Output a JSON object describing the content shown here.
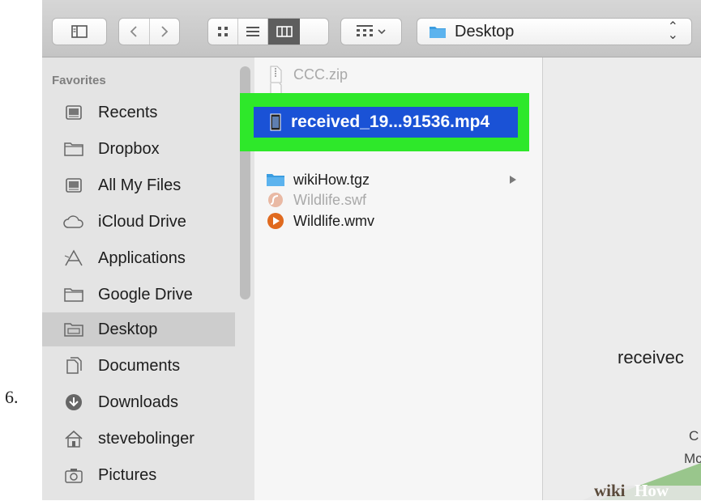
{
  "step_number": "6.",
  "toolbar": {
    "path_label": "Desktop",
    "path_chevron": "⌃⌄"
  },
  "sidebar": {
    "header": "Favorites",
    "items": [
      {
        "label": "Recents",
        "icon": "recents-icon"
      },
      {
        "label": "Dropbox",
        "icon": "folder-icon"
      },
      {
        "label": "All My Files",
        "icon": "all-files-icon"
      },
      {
        "label": "iCloud Drive",
        "icon": "cloud-icon"
      },
      {
        "label": "Applications",
        "icon": "applications-icon"
      },
      {
        "label": "Google Drive",
        "icon": "folder-icon"
      },
      {
        "label": "Desktop",
        "icon": "desktop-folder-icon",
        "active": true
      },
      {
        "label": "Documents",
        "icon": "documents-icon"
      },
      {
        "label": "Downloads",
        "icon": "downloads-icon"
      },
      {
        "label": "stevebolinger",
        "icon": "home-icon"
      },
      {
        "label": "Pictures",
        "icon": "camera-icon"
      }
    ]
  },
  "files": [
    {
      "name": "CCC.zip",
      "dim": true
    },
    {
      "name": "received_19...91536.mp4",
      "selected": true
    },
    {
      "name": "wikiHow.tgz"
    },
    {
      "name": "Wildlife.swf",
      "dim": true
    },
    {
      "name": "Wildlife.wmv"
    }
  ],
  "preview": {
    "title": "receivec",
    "line1": "C",
    "line2": "Mc"
  },
  "watermark": {
    "wiki": "wiki",
    "how": "How"
  },
  "colors": {
    "highlight": "#2ee82a",
    "selection": "#1a52d6",
    "folder": "#3b9de0"
  }
}
